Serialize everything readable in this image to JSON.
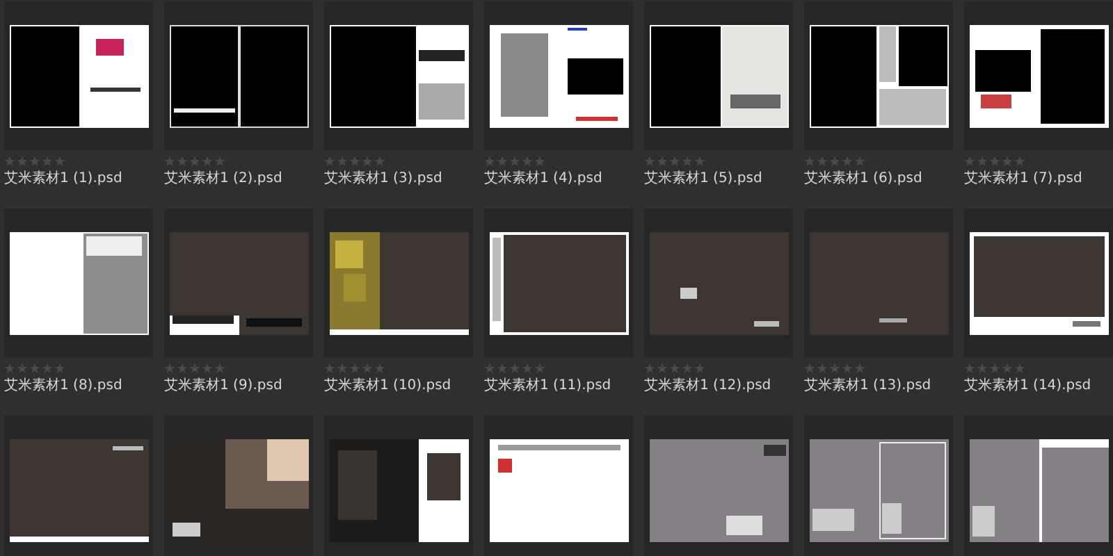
{
  "rows": [
    {
      "items": [
        {
          "thumbnail": {
            "kind": "picture"
          },
          "name": "艾米素材1 (1).psd",
          "stars": 0
        },
        {
          "thumbnail": {
            "kind": "picture"
          },
          "name": "艾米素材1 (2).psd",
          "stars": 0
        },
        {
          "thumbnail": {
            "kind": "picture"
          },
          "name": "艾米素材1 (3).psd",
          "stars": 0
        },
        {
          "thumbnail": {
            "kind": "picture"
          },
          "name": "艾米素材1 (4).psd",
          "stars": 0
        },
        {
          "thumbnail": {
            "kind": "picture"
          },
          "name": "艾米素材1 (5).psd",
          "stars": 0
        },
        {
          "thumbnail": {
            "kind": "picture"
          },
          "name": "艾米素材1 (6).psd",
          "stars": 0
        },
        {
          "thumbnail": {
            "kind": "picture"
          },
          "name": "艾米素材1 (7).psd",
          "stars": 0
        }
      ]
    },
    {
      "items": [
        {
          "thumbnail": {
            "kind": "picture"
          },
          "name": "艾米素材1 (8).psd",
          "stars": 0
        },
        {
          "thumbnail": {
            "kind": "picture"
          },
          "name": "艾米素材1 (9).psd",
          "stars": 0
        },
        {
          "thumbnail": {
            "kind": "picture"
          },
          "name": "艾米素材1 (10).psd",
          "stars": 0
        },
        {
          "thumbnail": {
            "kind": "picture"
          },
          "name": "艾米素材1 (11).psd",
          "stars": 0
        },
        {
          "thumbnail": {
            "kind": "picture"
          },
          "name": "艾米素材1 (12).psd",
          "stars": 0
        },
        {
          "thumbnail": {
            "kind": "picture"
          },
          "name": "艾米素材1 (13).psd",
          "stars": 0
        },
        {
          "thumbnail": {
            "kind": "picture"
          },
          "name": "艾米素材1 (14).psd",
          "stars": 0
        }
      ]
    },
    {
      "items": [
        {
          "thumbnail": {
            "kind": "picture"
          }
        },
        {
          "thumbnail": {
            "kind": "picture"
          }
        },
        {
          "thumbnail": {
            "kind": "picture"
          }
        },
        {
          "thumbnail": {
            "kind": "picture"
          }
        },
        {
          "thumbnail": {
            "kind": "picture"
          }
        },
        {
          "thumbnail": {
            "kind": "picture"
          }
        },
        {
          "thumbnail": {
            "kind": "picture"
          }
        }
      ]
    }
  ]
}
